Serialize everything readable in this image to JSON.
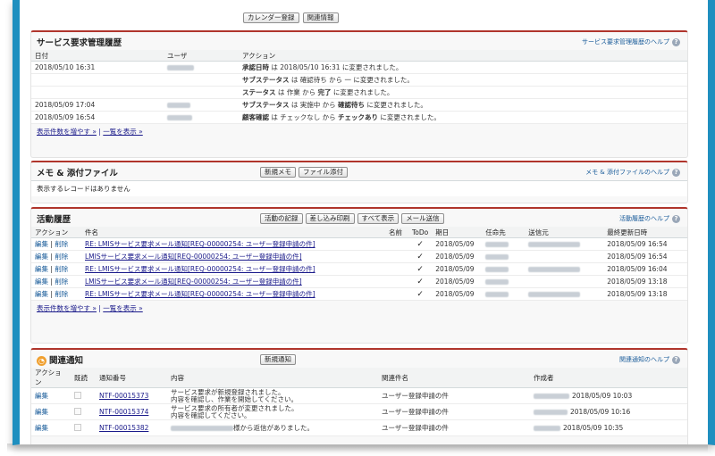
{
  "top_buttons": [
    "カレンダー登録",
    "関連情報"
  ],
  "service_history": {
    "title": "サービス要求管理履歴",
    "help": "サービス要求管理履歴のヘルプ",
    "columns": [
      "日付",
      "ユーザ",
      "アクション"
    ],
    "rows": [
      {
        "date": "2018/05/10 16:31",
        "user_w": 30,
        "action": {
          "pre": "承認日時",
          "mid": " は 2018/05/10 16:31 に変更されました。",
          "b1": "",
          "post": ""
        }
      },
      {
        "date": "",
        "user_w": 0,
        "action": {
          "pre": "サブステータス",
          "mid": " は 確認待ち から 一 に変更されました。",
          "b1": "",
          "post": ""
        }
      },
      {
        "date": "",
        "user_w": 0,
        "action": {
          "pre": "ステータス",
          "mid": " は 作業 から ",
          "b1": "完了",
          "post": " に変更されました。"
        }
      },
      {
        "date": "2018/05/09 17:04",
        "user_w": 26,
        "action": {
          "pre": "サブステータス",
          "mid": " は 実施中 から ",
          "b1": "確認待ち",
          "post": " に変更されました。"
        }
      },
      {
        "date": "2018/05/09 16:54",
        "user_w": 28,
        "action": {
          "pre": "顧客確認",
          "mid": " は チェックなし から ",
          "b1": "チェックあり",
          "post": " に変更されました。"
        }
      }
    ],
    "more_link": "表示件数を増やす »",
    "list_link": "一覧を表示 »",
    "separator": " | "
  },
  "attachments": {
    "title": "メモ & 添付ファイル",
    "buttons": [
      "新規メモ",
      "ファイル添付"
    ],
    "help": "メモ & 添付ファイルのヘルプ",
    "empty": "表示するレコードはありません"
  },
  "activity": {
    "title": "活動履歴",
    "buttons": [
      "活動の記録",
      "差し込み印刷",
      "すべて表示",
      "メール送信"
    ],
    "help": "活動履歴のヘルプ",
    "columns": [
      "アクション",
      "件名",
      "名前",
      "ToDo",
      "期日",
      "任命先",
      "送信元",
      "最終更新日時"
    ],
    "edit": "編集",
    "delete": "削除",
    "sep": " | ",
    "check": "✓",
    "rows": [
      {
        "subject": "RE: LMISサービス要求メール通知[REQ-00000254: ユーザー登録申請の件]",
        "due": "2018/05/09",
        "assignee_w": 26,
        "sender_w": 58,
        "updated": "2018/05/09 16:54"
      },
      {
        "subject": "LMISサービス要求メール通知[REQ-00000254: ユーザー登録申請の件]",
        "due": "2018/05/09",
        "assignee_w": 26,
        "sender_w": 0,
        "updated": "2018/05/09 16:54"
      },
      {
        "subject": "RE: LMISサービス要求メール通知[REQ-00000254: ユーザー登録申請の件]",
        "due": "2018/05/09",
        "assignee_w": 26,
        "sender_w": 58,
        "updated": "2018/05/09 16:04"
      },
      {
        "subject": "LMISサービス要求メール通知[REQ-00000254: ユーザー登録申請の件]",
        "due": "2018/05/09",
        "assignee_w": 26,
        "sender_w": 0,
        "updated": "2018/05/09 13:18"
      },
      {
        "subject": "RE: LMISサービス要求メール通知[REQ-00000254: ユーザー登録申請の件]",
        "due": "2018/05/09",
        "assignee_w": 26,
        "sender_w": 58,
        "updated": "2018/05/09 13:18"
      }
    ],
    "more_link": "表示件数を増やす »",
    "list_link": "一覧を表示 »",
    "separator": " | "
  },
  "notices": {
    "title": "関連通知",
    "buttons": [
      "新規通知"
    ],
    "help": "関連通知のヘルプ",
    "columns": [
      "アクション",
      "既読",
      "通知番号",
      "内容",
      "関連件名",
      "作成者"
    ],
    "edit": "編集",
    "rows": [
      {
        "number": "NTF-00015373",
        "content1": "サービス要求が新規登録されました。",
        "content2": "内容を確認し、作業を開始してください。",
        "related": "ユーザー登録申請の件",
        "creator_w": 40,
        "created": "2018/05/09 10:03"
      },
      {
        "number": "NTF-00015374",
        "content1": "サービス要求の所有者が変更されました。",
        "content2": "内容を確認してください。",
        "related": "ユーザー登録申請の件",
        "creator_w": 38,
        "created": "2018/05/09 10:16"
      },
      {
        "number": "NTF-00015382",
        "content1": "様から返信がありました。",
        "content2": "",
        "related": "ユーザー登録申請の件",
        "creator_w": 30,
        "created": "2018/05/09 10:35"
      }
    ]
  }
}
